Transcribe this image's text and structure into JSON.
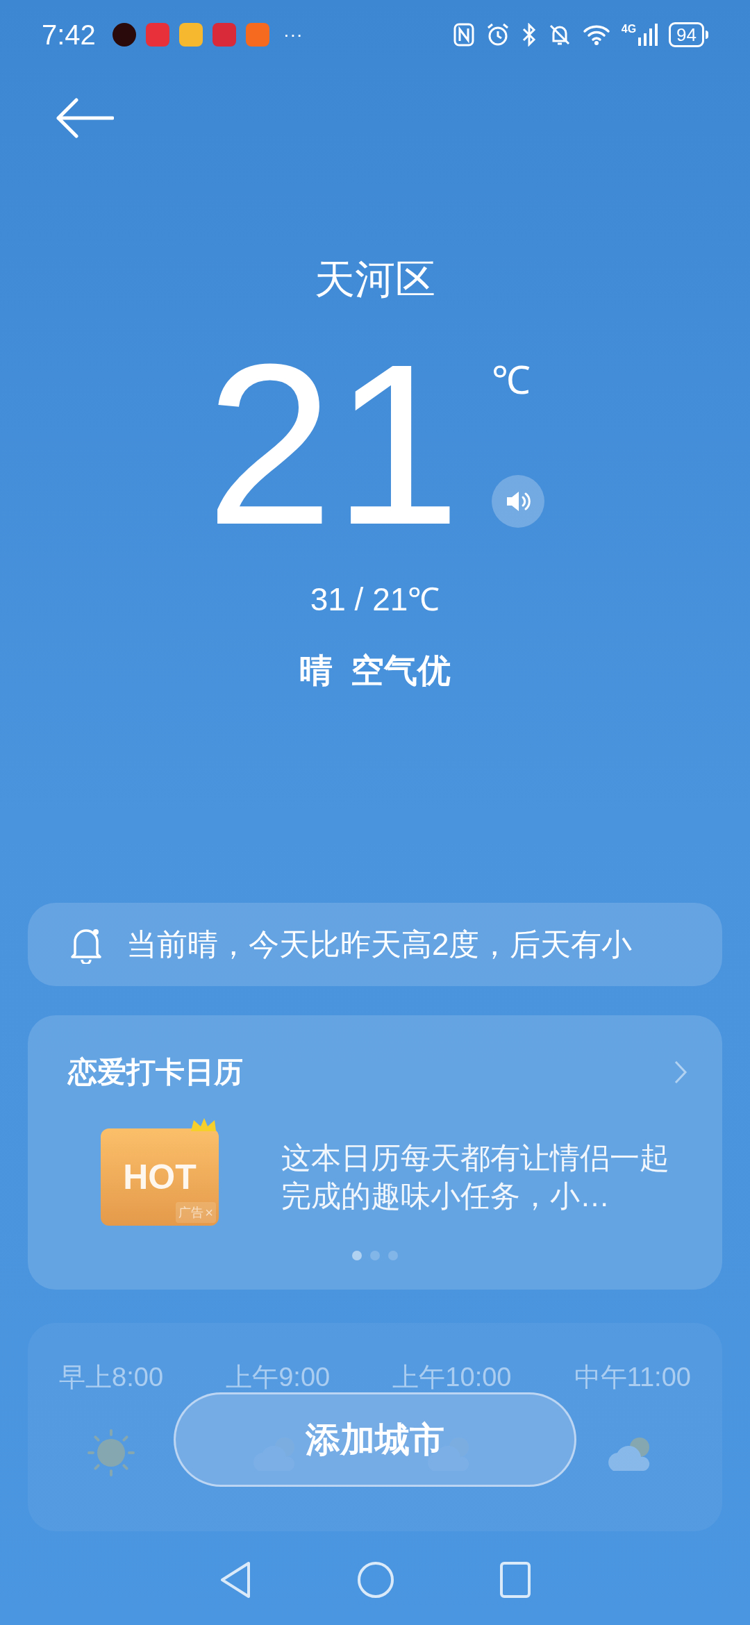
{
  "status_bar": {
    "time": "7:42",
    "more": "···",
    "network": "4G",
    "battery": "94"
  },
  "location": {
    "city": "天河区",
    "temperature": "21",
    "unit": "℃",
    "range": "31 / 21℃",
    "condition": "晴  空气优"
  },
  "notice": {
    "text": "当前晴，今天比昨天高2度，后天有小"
  },
  "ad_card": {
    "title": "恋爱打卡日历",
    "badge": "HOT",
    "ad_label": "广告",
    "ad_close": "×",
    "description": "这本日历每天都有让情侣一起完成的趣味小任务，小…",
    "pages": [
      {
        "selected": true
      },
      {
        "selected": false
      },
      {
        "selected": false
      }
    ]
  },
  "hourly": [
    {
      "time": "早上8:00",
      "kind": "sun"
    },
    {
      "time": "上午9:00",
      "kind": "cloud-sun"
    },
    {
      "time": "上午10:00",
      "kind": "cloud-sun"
    },
    {
      "time": "中午11:00",
      "kind": "cloud-sun"
    }
  ],
  "add_city_button": "添加城市"
}
